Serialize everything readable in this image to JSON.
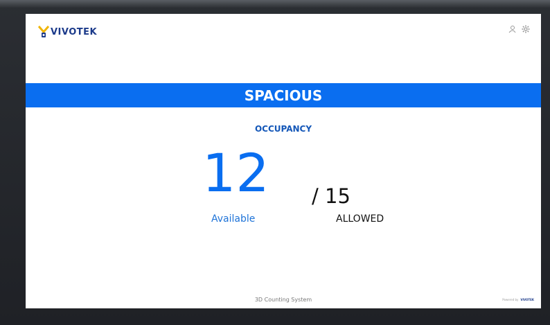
{
  "header": {
    "logo_text": "VIVOTEK",
    "icons": [
      "user-icon",
      "gear-icon"
    ]
  },
  "banner": {
    "status": "SPACIOUS"
  },
  "occupancy": {
    "label": "OCCUPANCY",
    "available_count": "12",
    "available_label": "Available",
    "allowed_value": "/ 15",
    "allowed_label": "ALLOWED"
  },
  "footer": {
    "system_name": "3D Counting System",
    "powered_by": "Powered by",
    "powered_logo": "VIVOTEK"
  },
  "colors": {
    "accent": "#0a6ef0",
    "brand": "#1b3a8a"
  }
}
